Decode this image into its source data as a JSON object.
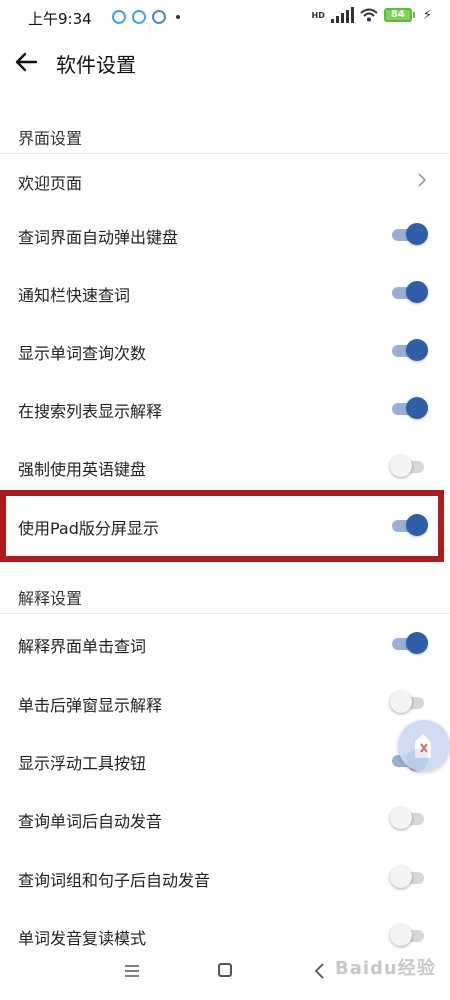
{
  "status_bar": {
    "time": "上午9:34",
    "network_type": "HD",
    "battery_level": "84",
    "charging_icon": "lightning-icon"
  },
  "header": {
    "back_icon": "arrow-left-icon",
    "title": "软件设置"
  },
  "sections": [
    {
      "title": "界面设置",
      "items": [
        {
          "label": "欢迎页面",
          "control": "chevron"
        },
        {
          "label": "查词界面自动弹出键盘",
          "control": "toggle",
          "on": true
        },
        {
          "label": "通知栏快速查词",
          "control": "toggle",
          "on": true
        },
        {
          "label": "显示单词查询次数",
          "control": "toggle",
          "on": true
        },
        {
          "label": "在搜索列表显示解释",
          "control": "toggle",
          "on": true
        },
        {
          "label": "强制使用英语键盘",
          "control": "toggle",
          "on": false
        },
        {
          "label": "使用Pad版分屏显示",
          "control": "toggle",
          "on": true,
          "highlighted": true
        }
      ]
    },
    {
      "title": "解释设置",
      "items": [
        {
          "label": "解释界面单击查词",
          "control": "toggle",
          "on": true
        },
        {
          "label": "单击后弹窗显示解释",
          "control": "toggle",
          "on": false
        },
        {
          "label": "显示浮动工具按钮",
          "control": "toggle",
          "on": true
        },
        {
          "label": "查询单词后自动发音",
          "control": "toggle",
          "on": false
        },
        {
          "label": "查询词组和句子后自动发音",
          "control": "toggle",
          "on": false
        },
        {
          "label": "单词发音复读模式",
          "control": "toggle",
          "on": false
        }
      ]
    }
  ],
  "colors": {
    "accent": "#2f5fa8",
    "highlight_border": "#b01c1c"
  },
  "nav_bar": {
    "menu_icon": "menu-lines-icon",
    "home_icon": "square-home-icon",
    "back_icon": "chevron-left-icon"
  },
  "watermark": "Baidu经验"
}
